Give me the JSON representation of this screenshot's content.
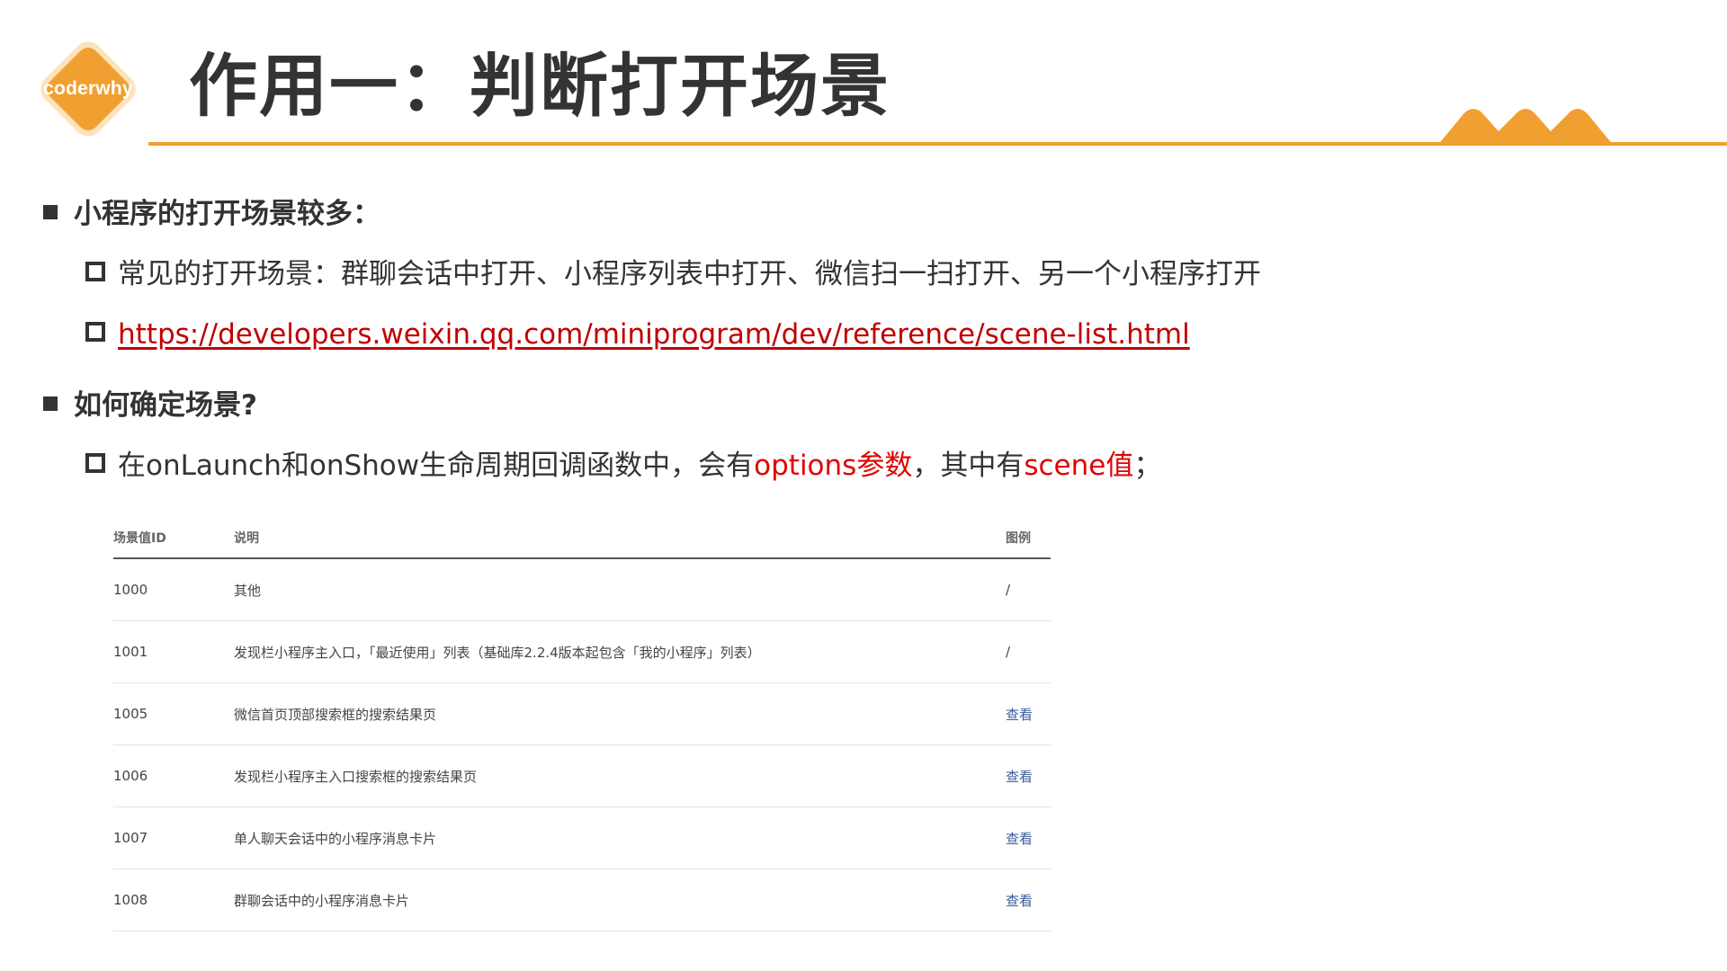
{
  "logo": {
    "text": "coderwhy",
    "color": "#f0a030"
  },
  "title": "作用一：判断打开场景",
  "colors": {
    "accent": "#f0a030",
    "highlight": "#e00000",
    "link": "#c00000",
    "table_link": "#3a5a9a"
  },
  "bullets": {
    "b1": "小程序的打开场景较多：",
    "b1_1": "常见的打开场景：群聊会话中打开、小程序列表中打开、微信扫一扫打开、另一个小程序打开",
    "b1_2_link": "https://developers.weixin.qq.com/miniprogram/dev/reference/scene-list.html",
    "b2": "如何确定场景?",
    "b2_1": {
      "part1": "在onLaunch和onShow生命周期回调函数中，会有",
      "hl1": "options参数",
      "part2": "，其中有",
      "hl2": "scene值",
      "part3": "；"
    }
  },
  "table": {
    "headers": [
      "场景值ID",
      "说明",
      "图例"
    ],
    "rows": [
      {
        "id": "1000",
        "desc": "其他",
        "legend": "/"
      },
      {
        "id": "1001",
        "desc": "发现栏小程序主入口，「最近使用」列表（基础库2.2.4版本起包含「我的小程序」列表）",
        "legend": "/"
      },
      {
        "id": "1005",
        "desc": "微信首页顶部搜索框的搜索结果页",
        "legend": "查看"
      },
      {
        "id": "1006",
        "desc": "发现栏小程序主入口搜索框的搜索结果页",
        "legend": "查看"
      },
      {
        "id": "1007",
        "desc": "单人聊天会话中的小程序消息卡片",
        "legend": "查看"
      },
      {
        "id": "1008",
        "desc": "群聊会话中的小程序消息卡片",
        "legend": "查看"
      }
    ]
  }
}
